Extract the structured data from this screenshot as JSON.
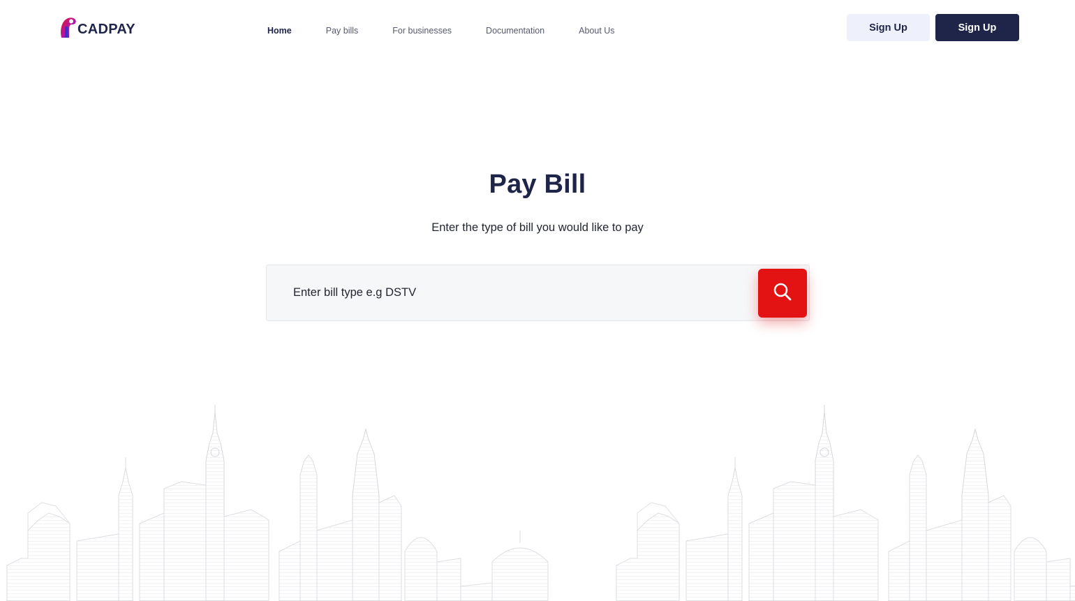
{
  "brand": {
    "logo_text": "CADPAY",
    "colors": {
      "navy": "#1e2548",
      "red": "#e31313",
      "light_button": "#eef1fb",
      "logo_gradient_start": "#e3132c",
      "logo_gradient_end": "#3b2fc9"
    }
  },
  "nav": {
    "items": [
      {
        "label": "Home",
        "active": true
      },
      {
        "label": "Pay bills",
        "active": false
      },
      {
        "label": "For businesses",
        "active": false
      },
      {
        "label": "Documentation",
        "active": false
      },
      {
        "label": "About Us",
        "active": false
      }
    ]
  },
  "header": {
    "secondary_button_label": "Sign Up",
    "primary_button_label": "Sign Up"
  },
  "hero": {
    "title": "Pay Bill",
    "subtitle": "Enter the type of bill you would like to pay"
  },
  "search": {
    "placeholder": "Enter bill type e.g DSTV",
    "value": "",
    "button_icon": "search-icon"
  },
  "decoration": {
    "background_icon": "city-skyline-sketch"
  }
}
